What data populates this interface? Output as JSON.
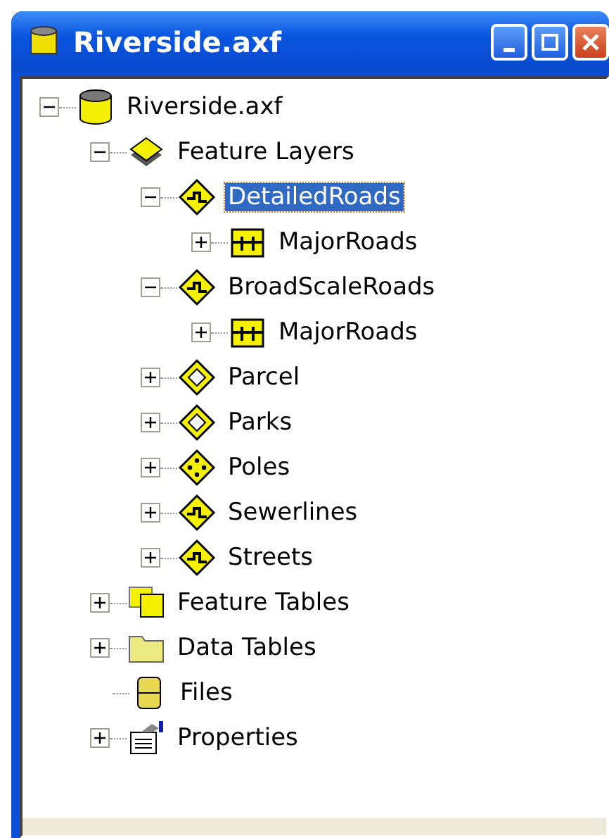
{
  "window": {
    "title": "Riverside.axf"
  },
  "tree": [
    {
      "label": "Riverside.axf",
      "kind": "database",
      "expanded": true,
      "selected": false,
      "children": [
        {
          "label": "Feature Layers",
          "kind": "layers",
          "expanded": true,
          "selected": false,
          "children": [
            {
              "label": "DetailedRoads",
              "kind": "line",
              "expanded": true,
              "selected": true,
              "children": [
                {
                  "label": "MajorRoads",
                  "kind": "table",
                  "expanded": false,
                  "selected": false
                }
              ]
            },
            {
              "label": "BroadScaleRoads",
              "kind": "line",
              "expanded": true,
              "selected": false,
              "children": [
                {
                  "label": "MajorRoads",
                  "kind": "table",
                  "expanded": false,
                  "selected": false
                }
              ]
            },
            {
              "label": "Parcel",
              "kind": "polygon",
              "expanded": false,
              "selected": false
            },
            {
              "label": "Parks",
              "kind": "polygon",
              "expanded": false,
              "selected": false
            },
            {
              "label": "Poles",
              "kind": "point",
              "expanded": false,
              "selected": false
            },
            {
              "label": "Sewerlines",
              "kind": "line",
              "expanded": false,
              "selected": false
            },
            {
              "label": "Streets",
              "kind": "line",
              "expanded": false,
              "selected": false
            }
          ]
        },
        {
          "label": "Feature Tables",
          "kind": "feature-tables",
          "expanded": false,
          "selected": false
        },
        {
          "label": "Data Tables",
          "kind": "folder",
          "expanded": false,
          "selected": false
        },
        {
          "label": "Files",
          "kind": "files",
          "selected": false
        },
        {
          "label": "Properties",
          "kind": "properties",
          "expanded": false,
          "selected": false
        }
      ]
    }
  ]
}
